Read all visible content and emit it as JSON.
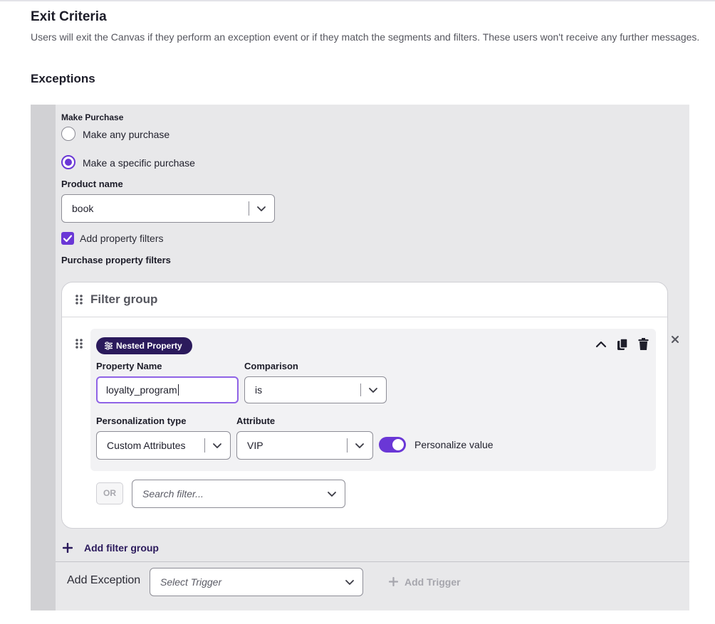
{
  "exit_criteria": {
    "title": "Exit Criteria",
    "description": "Users will exit the Canvas if they perform an exception event or if they match the segments and filters. These users won't receive any further messages.",
    "exceptions_title": "Exceptions"
  },
  "purchase": {
    "section_label": "Make Purchase",
    "options": [
      {
        "label": "Make any purchase",
        "selected": false
      },
      {
        "label": "Make a specific purchase",
        "selected": true
      }
    ],
    "product_name_label": "Product name",
    "product_name_value": "book",
    "add_property_filters_label": "Add property filters",
    "add_property_filters_checked": true,
    "purchase_property_filters_label": "Purchase property filters"
  },
  "filter_group": {
    "title": "Filter group",
    "filter": {
      "badge": "Nested Property",
      "property_name_label": "Property Name",
      "property_name_value": "loyalty_program",
      "comparison_label": "Comparison",
      "comparison_value": "is",
      "personalization_type_label": "Personalization type",
      "personalization_type_value": "Custom Attributes",
      "attribute_label": "Attribute",
      "attribute_value": "VIP",
      "personalize_value_label": "Personalize value",
      "personalize_value_on": true
    },
    "or_label": "OR",
    "search_filter_placeholder": "Search filter..."
  },
  "add_filter_group_label": "Add filter group",
  "footer": {
    "add_exception_label": "Add Exception",
    "select_trigger_placeholder": "Select Trigger",
    "add_trigger_label": "Add Trigger"
  },
  "colors": {
    "accent": "#6a37d6",
    "badge_bg": "#2b1a5c",
    "panel_bg": "#e8e8ea"
  }
}
